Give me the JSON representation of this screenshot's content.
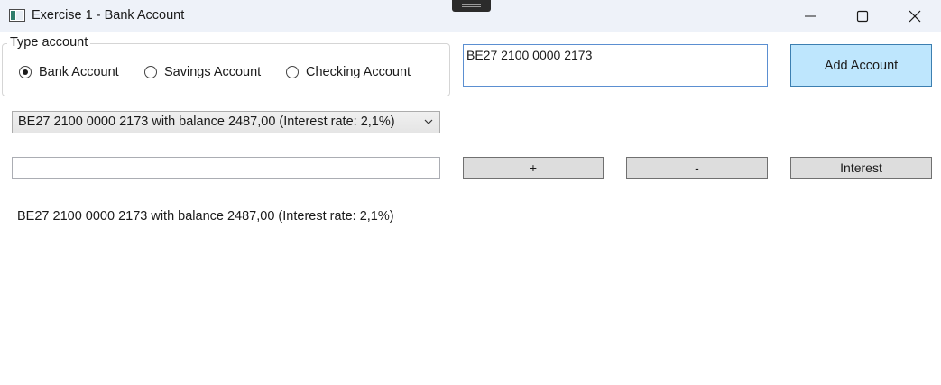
{
  "window": {
    "title": "Exercise 1 - Bank Account"
  },
  "type_group": {
    "legend": "Type account",
    "options": [
      {
        "label": "Bank Account",
        "checked": true
      },
      {
        "label": "Savings Account",
        "checked": false
      },
      {
        "label": "Checking Account",
        "checked": false
      }
    ]
  },
  "account_input": {
    "value": "BE27 2100 0000 2173"
  },
  "add_button": {
    "label": "Add Account"
  },
  "account_select": {
    "selected": "BE27 2100 0000 2173 with balance 2487,00 (Interest rate: 2,1%)"
  },
  "amount_input": {
    "value": ""
  },
  "operations": {
    "plus_label": "+",
    "minus_label": "-",
    "interest_label": "Interest"
  },
  "info": {
    "text": "BE27 2100 0000 2173 with balance 2487,00 (Interest rate: 2,1%)"
  },
  "icons": {
    "app": "window-app-icon",
    "minimize": "minimize-icon",
    "maximize": "maximize-icon",
    "close": "close-icon",
    "dropdown": "chevron-down-icon"
  },
  "colors": {
    "titlebar": "#eef2f9",
    "add_button_bg": "#bee6fd",
    "add_button_border": "#3c7fb1",
    "input_focus_border": "#5b8fd1",
    "button_bg": "#dddddd"
  }
}
